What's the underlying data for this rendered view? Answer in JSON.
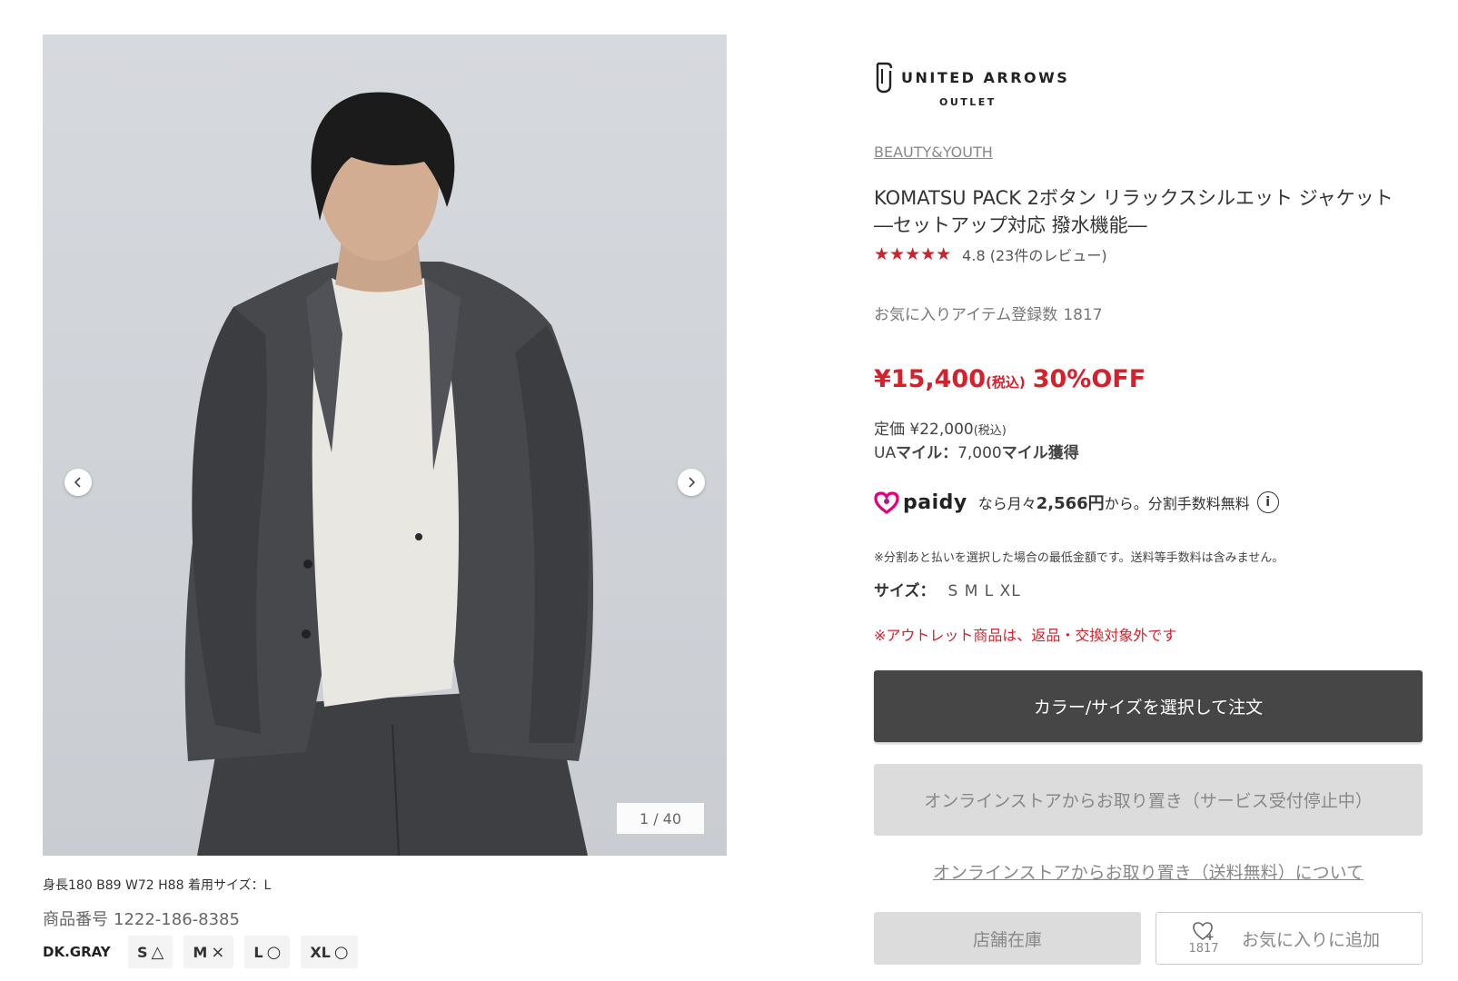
{
  "gallery": {
    "counter": "1 / 40",
    "model_info": "身長180 B89 W72 H88 着用サイズ：L",
    "product_no_label": "商品番号",
    "product_no": "1222-186-8385",
    "color_name": "DK.GRAY",
    "sizes": [
      {
        "size": "S",
        "stock": "△"
      },
      {
        "size": "M",
        "stock": "×"
      },
      {
        "size": "L",
        "stock": "○"
      },
      {
        "size": "XL",
        "stock": "○"
      }
    ]
  },
  "store": {
    "logo_main": "UNITED ARROWS",
    "logo_sub": "OUTLET"
  },
  "product": {
    "brand": "BEAUTY&YOUTH",
    "title_line1": "KOMATSU PACK 2ボタン リラックスシルエット ジャケット",
    "title_line2": "―セットアップ対応 撥水機能―",
    "stars": "★★★★★",
    "rating": "4.8",
    "reviews": "(23件のレビュー)",
    "favorites_label": "お気に入りアイテム登録数",
    "favorites_count": "1817",
    "price": "¥15,400",
    "price_tax": "(税込)",
    "discount": "30%OFF",
    "list_price_label": "定価 ¥22,000",
    "list_price_tax": "(税込)",
    "miles_prefix": "UA",
    "miles_label": "マイル：",
    "miles_value": "7,000",
    "miles_suffix": "マイル獲得",
    "paidy_word": "paidy",
    "paidy_pre": "なら月々",
    "paidy_amount": "2,566円",
    "paidy_post": "から。分割手数料無料",
    "installment_note": "※分割あと払いを選択した場合の最低金額です。送料等手数料は含みません。",
    "size_label": "サイズ：",
    "size_values": "S M L XL",
    "outlet_note": "※アウトレット商品は、返品・交換対象外です"
  },
  "buttons": {
    "order": "カラー/サイズを選択して注文",
    "reserve": "オンラインストアからお取り置き（サービス受付停止中）",
    "reserve_link": "オンラインストアからお取り置き（送料無料）について",
    "store_stock": "店舗在庫",
    "fav_count": "1817",
    "fav_add": "お気に入りに追加"
  },
  "colors": {
    "accent_red": "#d6202b",
    "star_red": "#c8252d",
    "button_dark": "#464646",
    "button_disabled": "#dcdcdc",
    "paidy_magenta": "#e3007f"
  }
}
